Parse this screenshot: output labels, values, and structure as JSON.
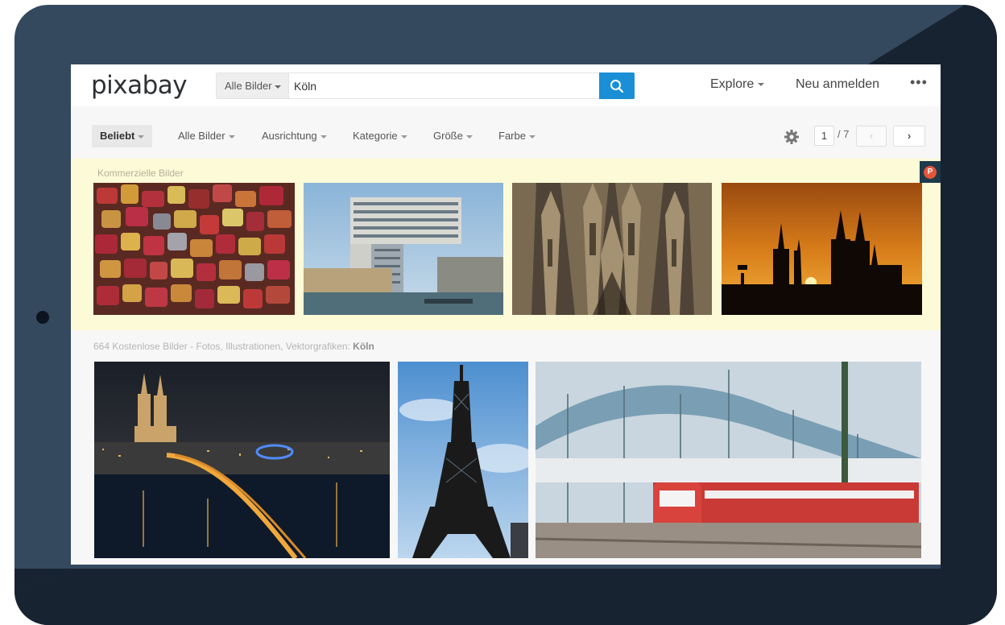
{
  "header": {
    "logo": "pixabay",
    "search_type": "Alle Bilder",
    "search_value": "Köln",
    "explore": "Explore",
    "signup": "Neu anmelden",
    "more": "•••"
  },
  "filters": {
    "sort": "Beliebt",
    "type": "Alle Bilder",
    "orientation": "Ausrichtung",
    "category": "Kategorie",
    "size": "Größe",
    "color": "Farbe"
  },
  "pagination": {
    "current": "1",
    "total": "/ 7",
    "prev": "‹",
    "next": "›"
  },
  "commercial": {
    "label": "Kommerzielle Bilder",
    "badge": "P"
  },
  "results": {
    "prefix": "664 Kostenlose Bilder - Fotos, Illustrationen, Vektorgrafiken: ",
    "query": "Köln"
  },
  "icons": [
    "search-icon",
    "gear-icon",
    "chevron-left-icon",
    "chevron-right-icon",
    "pixabay-badge-icon"
  ],
  "colors": {
    "accent": "#1a8fd6",
    "tablet": "#34495e",
    "commercial_band": "#fdfad7"
  }
}
